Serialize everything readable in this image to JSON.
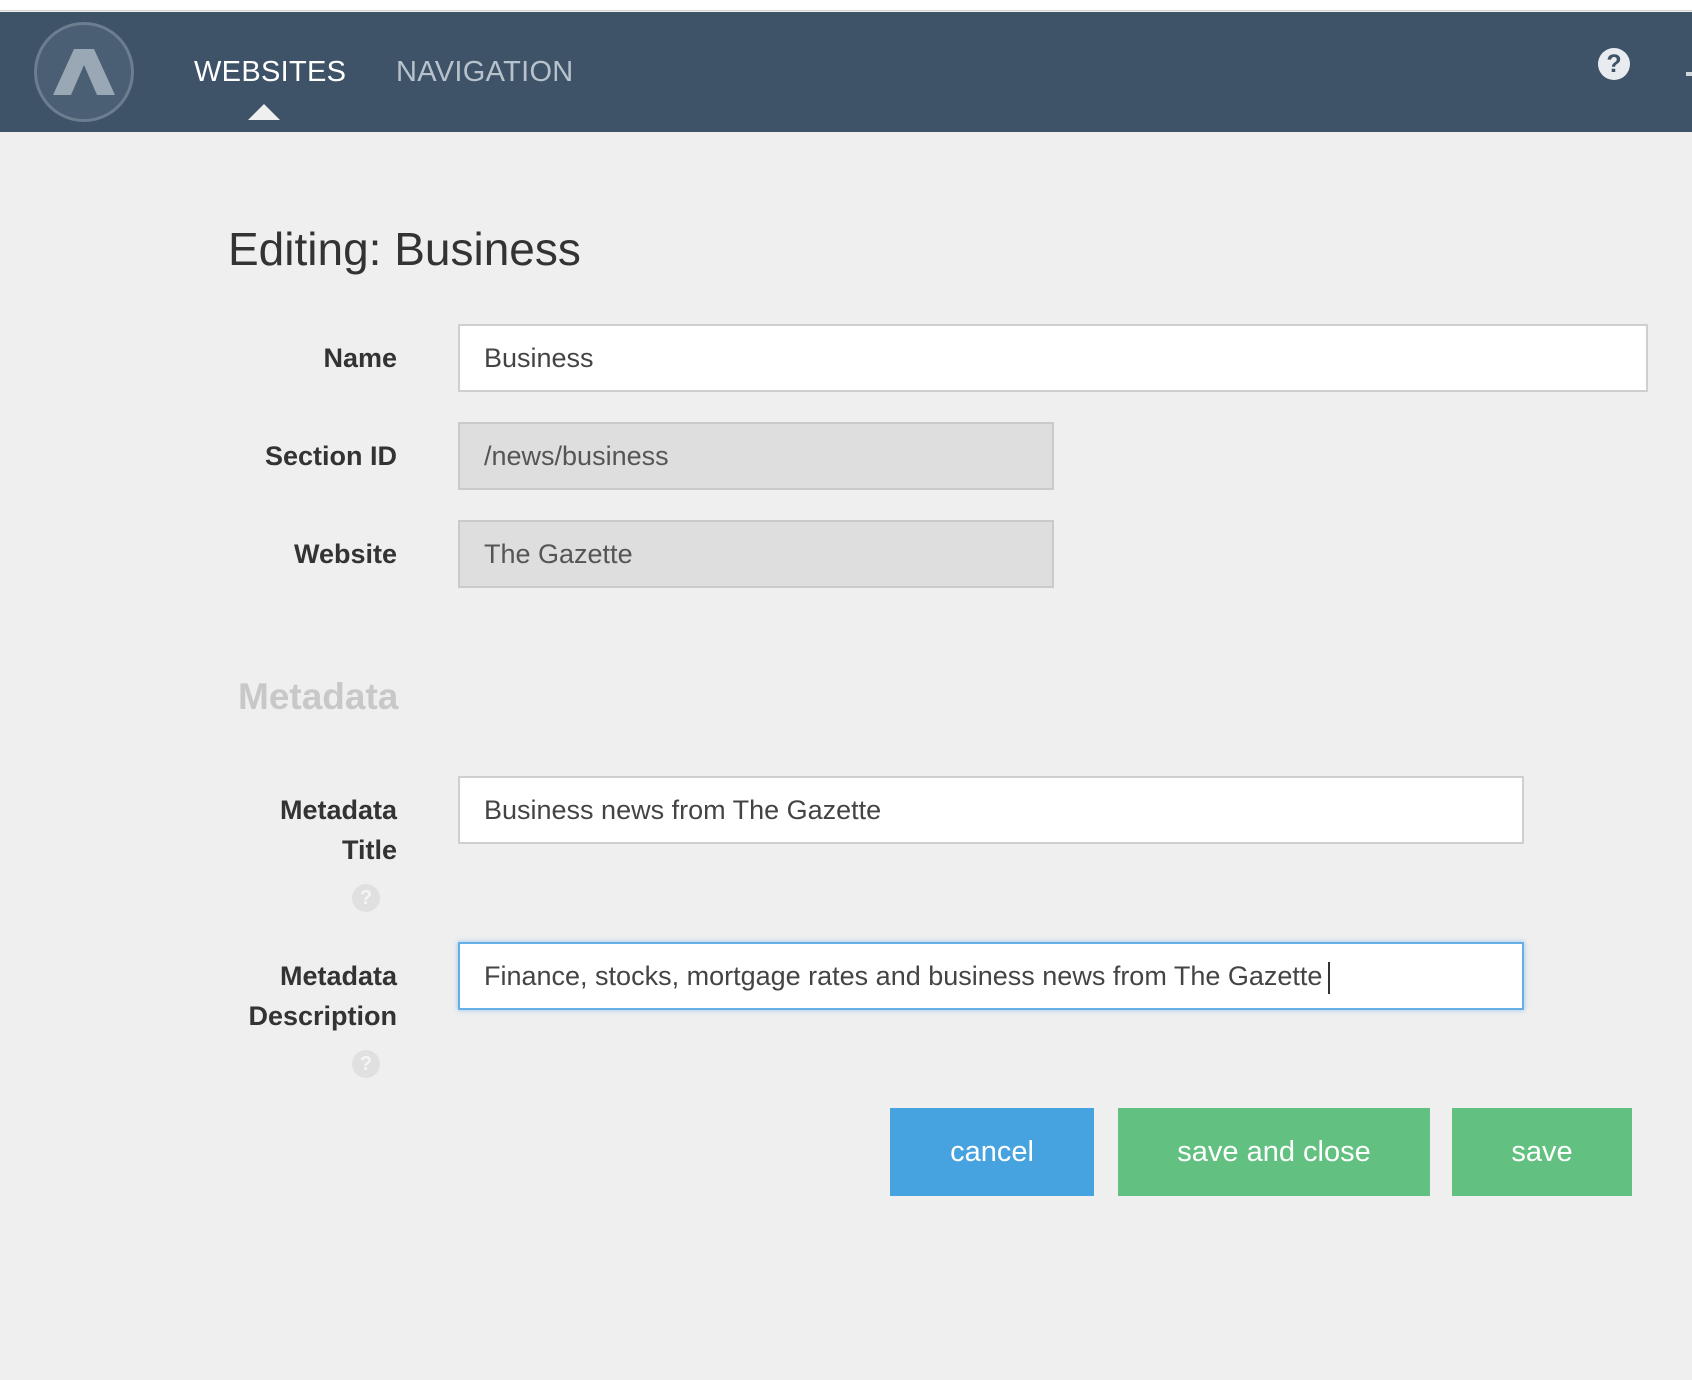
{
  "nav": {
    "tabs": [
      {
        "label": "WEBSITES",
        "active": true
      },
      {
        "label": "NAVIGATION",
        "active": false
      }
    ],
    "help_icon": "question-circle-icon",
    "logo_icon": "a-logo-icon"
  },
  "page": {
    "title": "Editing: Business"
  },
  "form": {
    "name": {
      "label": "Name",
      "value": "Business"
    },
    "section_id": {
      "label": "Section ID",
      "value": "/news/business"
    },
    "website": {
      "label": "Website",
      "value": "The Gazette"
    }
  },
  "metadata": {
    "heading": "Metadata",
    "title": {
      "label_line1": "Metadata",
      "label_line2": "Title",
      "value": "Business news from The Gazette"
    },
    "description": {
      "label_line1": "Metadata",
      "label_line2": "Description",
      "value": "Finance, stocks, mortgage rates and business news from The Gazette"
    }
  },
  "actions": {
    "cancel": "cancel",
    "save_and_close": "save and close",
    "save": "save"
  },
  "colors": {
    "navbar": "#3e5368",
    "cancel": "#47a3df",
    "save": "#62c080",
    "background": "#efefef"
  }
}
